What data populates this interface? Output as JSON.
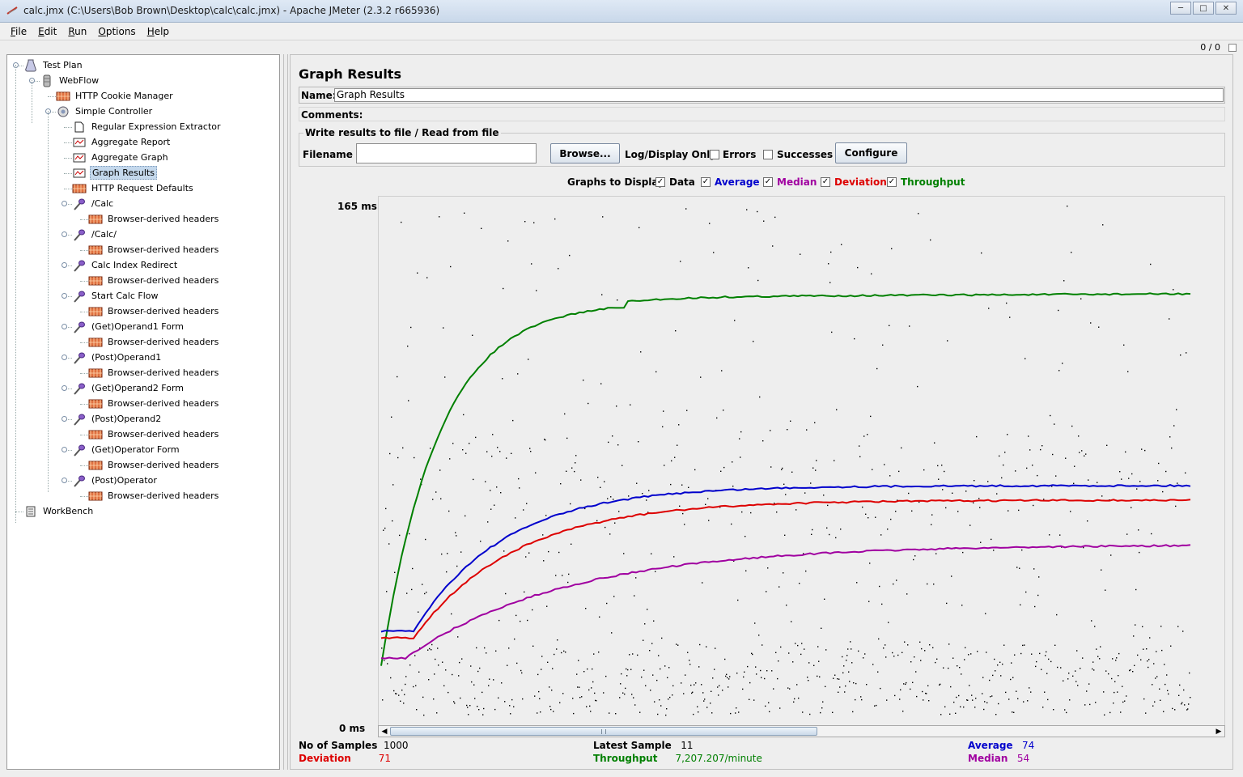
{
  "window": {
    "title": "calc.jmx (C:\\Users\\Bob Brown\\Desktop\\calc\\calc.jmx) - Apache JMeter (2.3.2 r665936)"
  },
  "menu": {
    "items": [
      "File",
      "Edit",
      "Run",
      "Options",
      "Help"
    ]
  },
  "status_counter": "0 / 0",
  "tree": {
    "items": [
      {
        "label": "Test Plan",
        "icon": "test-plan-icon"
      },
      {
        "label": "WebFlow",
        "icon": "thread-group-icon"
      },
      {
        "label": "HTTP Cookie Manager",
        "icon": "config-element-icon"
      },
      {
        "label": "Simple Controller",
        "icon": "controller-icon"
      },
      {
        "label": "Regular Expression Extractor",
        "icon": "post-processor-icon"
      },
      {
        "label": "Aggregate Report",
        "icon": "listener-icon"
      },
      {
        "label": "Aggregate Graph",
        "icon": "listener-icon"
      },
      {
        "label": "Graph Results",
        "icon": "listener-icon",
        "selected": true
      },
      {
        "label": "HTTP Request Defaults",
        "icon": "config-element-icon"
      },
      {
        "label": "/Calc",
        "icon": "sampler-icon"
      },
      {
        "label": "Browser-derived headers",
        "icon": "config-element-icon"
      },
      {
        "label": "/Calc/",
        "icon": "sampler-icon"
      },
      {
        "label": "Browser-derived headers",
        "icon": "config-element-icon"
      },
      {
        "label": "Calc Index Redirect",
        "icon": "sampler-icon"
      },
      {
        "label": "Browser-derived headers",
        "icon": "config-element-icon"
      },
      {
        "label": "Start Calc Flow",
        "icon": "sampler-icon"
      },
      {
        "label": "Browser-derived headers",
        "icon": "config-element-icon"
      },
      {
        "label": "(Get)Operand1 Form",
        "icon": "sampler-icon"
      },
      {
        "label": "Browser-derived headers",
        "icon": "config-element-icon"
      },
      {
        "label": "(Post)Operand1",
        "icon": "sampler-icon"
      },
      {
        "label": "Browser-derived headers",
        "icon": "config-element-icon"
      },
      {
        "label": "(Get)Operand2 Form",
        "icon": "sampler-icon"
      },
      {
        "label": "Browser-derived headers",
        "icon": "config-element-icon"
      },
      {
        "label": "(Post)Operand2",
        "icon": "sampler-icon"
      },
      {
        "label": "Browser-derived headers",
        "icon": "config-element-icon"
      },
      {
        "label": "(Get)Operator Form",
        "icon": "sampler-icon"
      },
      {
        "label": "Browser-derived headers",
        "icon": "config-element-icon"
      },
      {
        "label": "(Post)Operator",
        "icon": "sampler-icon"
      },
      {
        "label": "Browser-derived headers",
        "icon": "config-element-icon"
      },
      {
        "label": "WorkBench",
        "icon": "workbench-icon"
      }
    ]
  },
  "panel": {
    "title": "Graph Results",
    "name_label": "Name:",
    "name_value": "Graph Results",
    "comments_label": "Comments:",
    "file_section_title": "Write results to file / Read from file",
    "filename_label": "Filename",
    "filename_value": "",
    "browse_button": "Browse...",
    "log_display_label": "Log/Display Only:",
    "errors_label": "Errors",
    "successes_label": "Successes",
    "configure_button": "Configure",
    "graphs_to_display_label": "Graphs to Display",
    "toggles": [
      {
        "label": "Data",
        "checked": true,
        "color": "#000000"
      },
      {
        "label": "Average",
        "checked": true,
        "color": "#0000cc"
      },
      {
        "label": "Median",
        "checked": true,
        "color": "#a000a0"
      },
      {
        "label": "Deviation",
        "checked": true,
        "color": "#dd0000"
      },
      {
        "label": "Throughput",
        "checked": true,
        "color": "#008000"
      }
    ]
  },
  "graph": {
    "y_max_label": "165  ms",
    "y_min_label": "0  ms"
  },
  "stats": {
    "samples_label": "No of Samples",
    "samples_value": "1000",
    "latest_label": "Latest Sample",
    "latest_value": "11",
    "average_label": "Average",
    "average_value": "74",
    "deviation_label": "Deviation",
    "deviation_value": "71",
    "throughput_label": "Throughput",
    "throughput_value": "7,207.207/minute",
    "median_label": "Median",
    "median_value": "54"
  },
  "colors": {
    "data": "#000000",
    "average": "#0000cc",
    "median": "#a000a0",
    "deviation": "#dd0000",
    "throughput": "#008000",
    "selection": "#c4d8ec"
  }
}
